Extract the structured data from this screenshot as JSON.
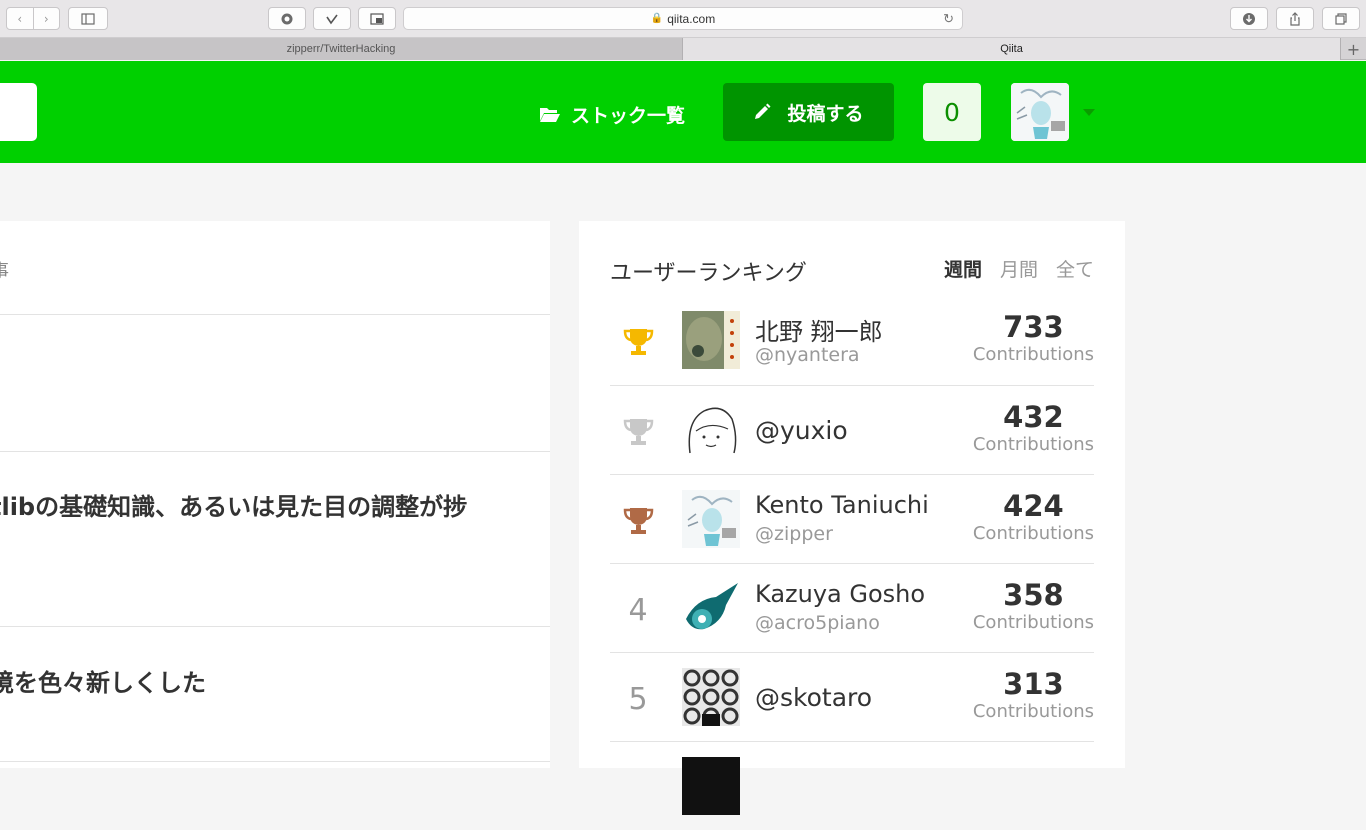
{
  "browser": {
    "address": "qiita.com",
    "tabs": [
      {
        "label": "zipperr/TwitterHacking"
      },
      {
        "label": "Qiita"
      }
    ]
  },
  "header": {
    "stock_label": "ストック一覧",
    "post_label": "投稿する",
    "notification_count": "0"
  },
  "feed": {
    "head_text": "事",
    "items": [
      {
        "title": ""
      },
      {
        "title": "tlibの基礎知識、あるいは見た目の調整が捗"
      },
      {
        "title": "境を色々新しくした"
      }
    ]
  },
  "ranking": {
    "title": "ユーザーランキング",
    "periods": [
      "週間",
      "月間",
      "全て"
    ],
    "active_period": "週間",
    "contributions_label": "Contributions",
    "rows": [
      {
        "rank": "1",
        "trophy": "gold-trophy-icon",
        "name": "北野 翔一郎",
        "handle": "@nyantera",
        "score": "733"
      },
      {
        "rank": "2",
        "trophy": "silver-trophy-icon",
        "name": "",
        "handle": "@yuxio",
        "score": "432"
      },
      {
        "rank": "3",
        "trophy": "bronze-trophy-icon",
        "name": "Kento Taniuchi",
        "handle": "@zipper",
        "score": "424"
      },
      {
        "rank": "4",
        "trophy": "",
        "name": "Kazuya Gosho",
        "handle": "@acro5piano",
        "score": "358"
      },
      {
        "rank": "5",
        "trophy": "",
        "name": "",
        "handle": "@skotaro",
        "score": "313"
      }
    ],
    "colors": {
      "gold": "#f5b800",
      "silver": "#c8c8c8",
      "bronze": "#b06a46"
    }
  },
  "colors": {
    "brand": "#00d000",
    "brand_dark": "#009400"
  }
}
